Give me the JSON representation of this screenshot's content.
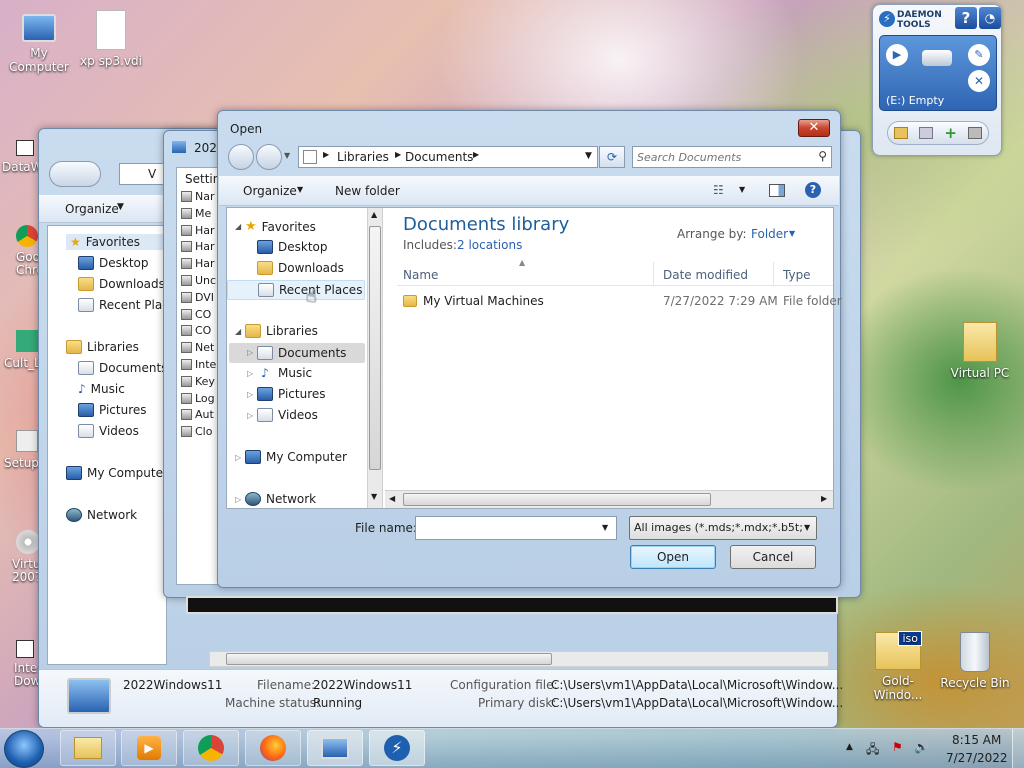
{
  "desktop": {
    "icons": [
      {
        "label": "My Computer"
      },
      {
        "label": "xp sp3.vdi"
      },
      {
        "label": "DataW"
      },
      {
        "label": "Goo Chro"
      },
      {
        "label": "Cult_L"
      },
      {
        "label": "Setup-"
      },
      {
        "label": "Virtu 2007"
      },
      {
        "label": "Inte Dow"
      },
      {
        "label": "Virtual PC"
      },
      {
        "label": "Gold-Windo..."
      },
      {
        "label": "Recycle Bin"
      }
    ]
  },
  "daemon": {
    "brand": "DAEMON TOOLS",
    "drive": "(E:) Empty"
  },
  "back_explorer": {
    "address": "V",
    "organize": "Organize",
    "nav": [
      "Favorites",
      "Desktop",
      "Downloads",
      "Recent Places",
      "Libraries",
      "Documents",
      "Music",
      "Pictures",
      "Videos",
      "My Computer",
      "Network"
    ],
    "details": {
      "name": "2022Windows11",
      "filename_label": "Filename:",
      "filename": "2022Windows11",
      "status_label": "Machine status:",
      "status": "Running",
      "config_label": "Configuration file:",
      "config": "C:\\Users\\vm1\\AppData\\Local\\Microsoft\\Window...",
      "disk_label": "Primary disk:",
      "disk": "C:\\Users\\vm1\\AppData\\Local\\Microsoft\\Window..."
    }
  },
  "settings_window": {
    "title": "2022",
    "tab": "Setting",
    "items": [
      "Nar",
      "Me",
      "Har",
      "Har",
      "Har",
      "Unc",
      "DVI",
      "CO",
      "CO",
      "Net",
      "Inte",
      "Key",
      "Log",
      "Aut",
      "Clo"
    ]
  },
  "dialog": {
    "title": "Open",
    "close_icon": "close-icon",
    "breadcrumb": [
      "Libraries",
      "Documents"
    ],
    "search_placeholder": "Search Documents",
    "organize": "Organize",
    "new_folder": "New folder",
    "nav": {
      "favorites": "Favorites",
      "fav_items": [
        "Desktop",
        "Downloads",
        "Recent Places"
      ],
      "libraries": "Libraries",
      "lib_items": [
        "Documents",
        "Music",
        "Pictures",
        "Videos"
      ],
      "computer": "My Computer",
      "network": "Network"
    },
    "library_title": "Documents library",
    "includes_label": "Includes:",
    "includes_link": "2 locations",
    "arrange_label": "Arrange by:",
    "arrange_value": "Folder",
    "columns": [
      "Name",
      "Date modified",
      "Type"
    ],
    "rows": [
      {
        "name": "My Virtual Machines",
        "date": "7/27/2022 7:29 AM",
        "type": "File folder"
      }
    ],
    "filename_label": "File name:",
    "filename_value": "",
    "filter": "All images (*.mds;*.mdx;*.b5t;*",
    "open": "Open",
    "cancel": "Cancel"
  },
  "taskbar": {
    "time": "8:15 AM",
    "date": "7/27/2022"
  }
}
